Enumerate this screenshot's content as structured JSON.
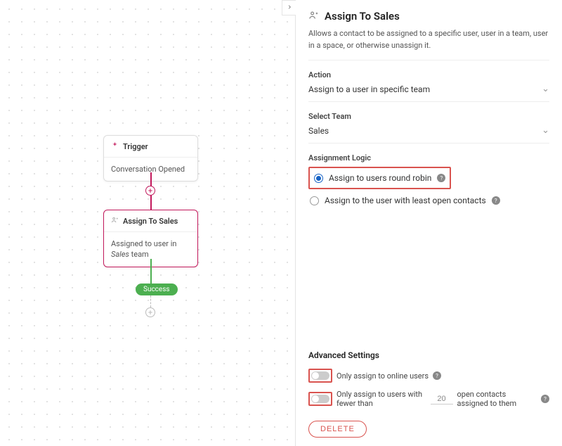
{
  "canvas": {
    "trigger": {
      "title": "Trigger",
      "body": "Conversation Opened"
    },
    "assign": {
      "title": "Assign To Sales",
      "body_prefix": "Assigned to user in ",
      "body_team": "Sales",
      "body_suffix": " team"
    },
    "success_label": "Success"
  },
  "panel": {
    "title": "Assign To Sales",
    "description": "Allows a contact to be assigned to a specific user, user in a team, user in a space, or otherwise unassign it.",
    "action": {
      "label": "Action",
      "value": "Assign to a user in specific team"
    },
    "team": {
      "label": "Select Team",
      "value": "Sales"
    },
    "logic": {
      "label": "Assignment Logic",
      "options": [
        {
          "label": "Assign to users round robin",
          "selected": true
        },
        {
          "label": "Assign to the user with least open contacts",
          "selected": false
        }
      ]
    },
    "advanced": {
      "title": "Advanced Settings",
      "online_label": "Only assign to online users",
      "fewer_prefix": "Only assign to users with fewer than",
      "fewer_value": "20",
      "fewer_suffix": "open contacts assigned to them"
    },
    "delete_label": "DELETE"
  }
}
